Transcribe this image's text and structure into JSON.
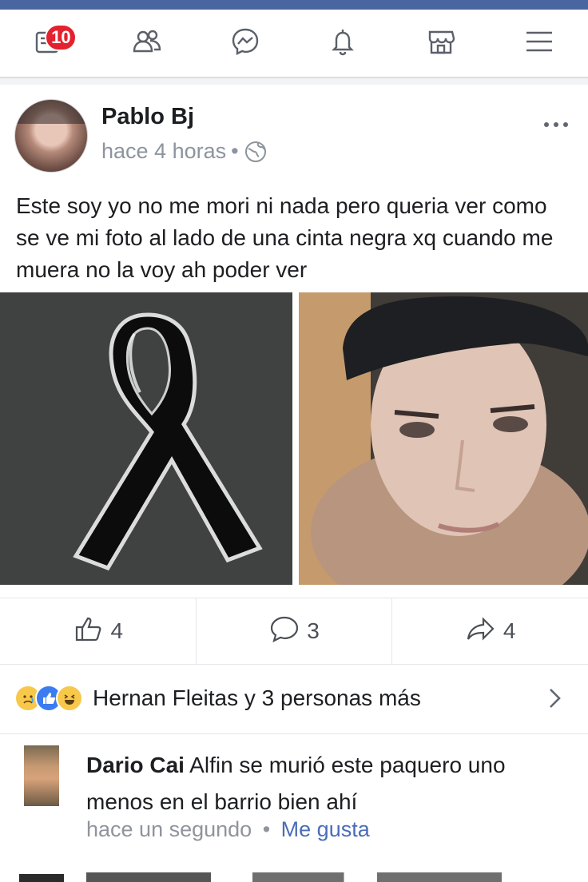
{
  "navbar": {
    "notification_count": "10",
    "icons": [
      "news-feed-icon",
      "friends-icon",
      "messenger-icon",
      "bell-icon",
      "marketplace-icon",
      "menu-icon"
    ]
  },
  "post": {
    "author": "Pablo Bj",
    "time": "hace 4 horas",
    "time_separator": "•",
    "text": "Este soy yo no me mori ni nada pero queria ver como se ve mi foto al lado de una cinta negra xq cuando me muera no la voy ah poder ver",
    "actions": {
      "likes": "4",
      "comments": "3",
      "shares": "4"
    },
    "reactions_summary": "Hernan Fleitas y 3 personas más"
  },
  "comment": {
    "author": "Dario Cai",
    "text": "Alfin se murió este paquero uno menos en el barrio bien ahí",
    "time": "hace un segundo",
    "separator": "•",
    "like_label": "Me gusta"
  },
  "colors": {
    "accent": "#4a66a0",
    "badge": "#e4212e",
    "link": "#4b6cb7"
  }
}
